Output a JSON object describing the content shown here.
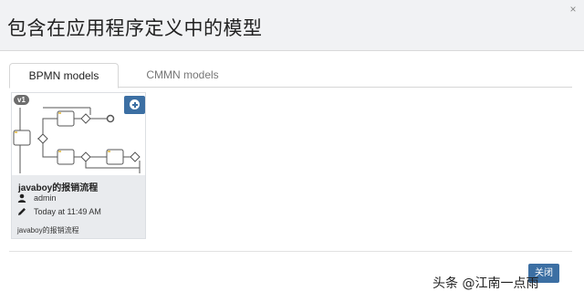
{
  "dialog": {
    "title": "包含在应用程序定义中的模型",
    "close_icon_glyph": "×"
  },
  "tabs": [
    {
      "label": "BPMN models",
      "active": true
    },
    {
      "label": "CMMN models",
      "active": false
    }
  ],
  "card": {
    "version": "v1",
    "name": "javaboy的报销流程",
    "owner": "admin",
    "modified": "Today at 11:49 AM",
    "description": "javaboy的报销流程",
    "icons": {
      "owner": "user-icon",
      "modified": "pencil-icon",
      "add": "plus-circle-icon"
    }
  },
  "footer": {
    "close_label": "关闭"
  },
  "watermark": "头条 @江南一点雨",
  "colors": {
    "primary": "#3c6fa3",
    "header_bg": "#f1f2f4",
    "card_bg": "#e9ebee",
    "badge_bg": "#6d6d6d"
  }
}
